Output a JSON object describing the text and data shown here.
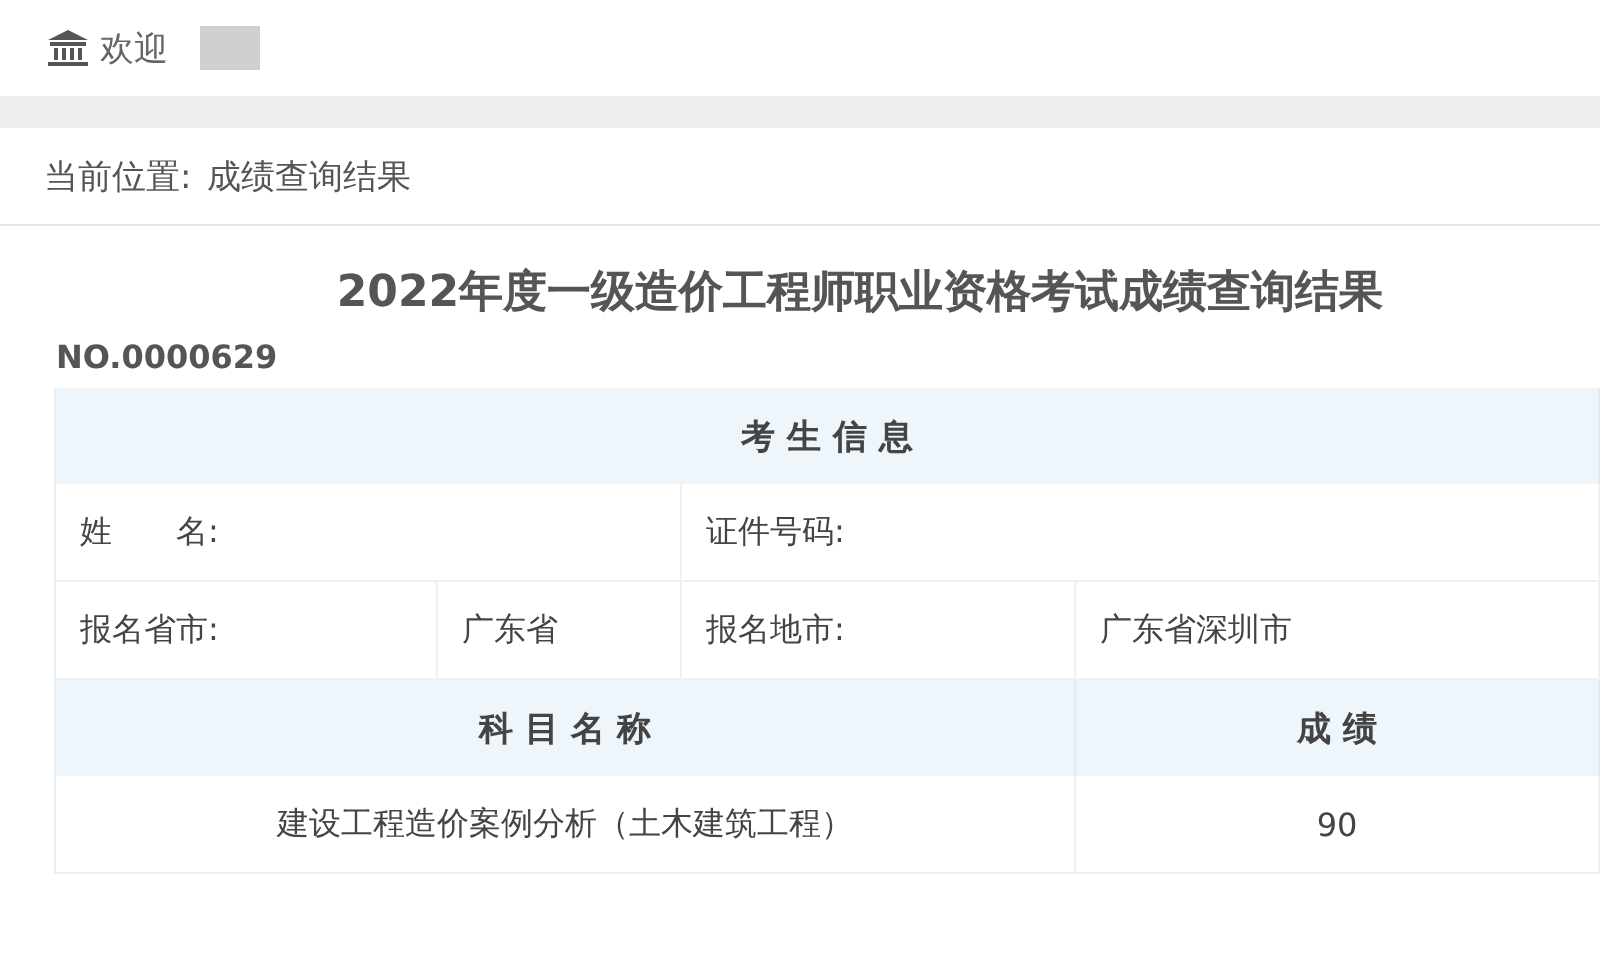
{
  "header": {
    "welcome": "欢迎"
  },
  "breadcrumb": {
    "label": "当前位置:",
    "current": "成绩查询结果"
  },
  "title": "2022年度一级造价工程师职业资格考试成绩查询结果",
  "number": "NO.0000629",
  "candidate": {
    "heading": "考 生 信 息",
    "name_label": "姓　　名:",
    "id_label": "证件号码:",
    "province_label": "报名省市:",
    "province": "广东省",
    "city_label": "报名地市:",
    "city": "广东省深圳市"
  },
  "scores": {
    "columns": [
      "科 目 名 称",
      "成 绩"
    ],
    "rows": [
      {
        "subject": "建设工程造价案例分析（土木建筑工程）",
        "score": "90"
      }
    ]
  }
}
